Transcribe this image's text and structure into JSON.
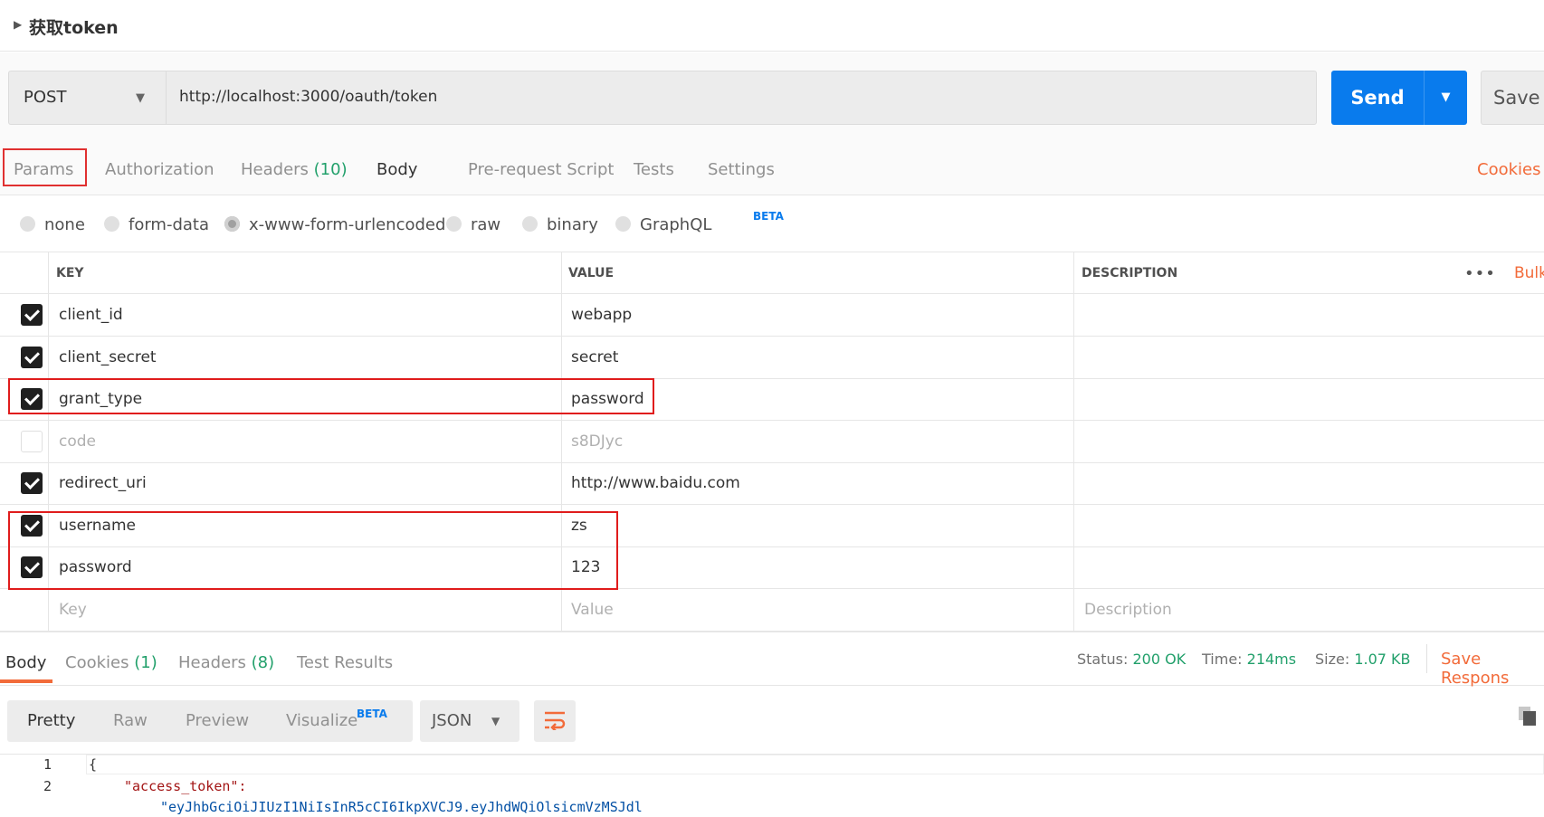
{
  "request": {
    "title": "获取token",
    "method": "POST",
    "url": "http://localhost:3000/oauth/token",
    "send_label": "Send",
    "save_label": "Save"
  },
  "tabs": {
    "params": "Params",
    "authorization": "Authorization",
    "headers": "Headers",
    "headers_count": "(10)",
    "body": "Body",
    "prerequest": "Pre-request Script",
    "tests": "Tests",
    "settings": "Settings",
    "cookies": "Cookies"
  },
  "body_modes": {
    "none": "none",
    "form_data": "form-data",
    "urlencoded": "x-www-form-urlencoded",
    "raw": "raw",
    "binary": "binary",
    "graphql": "GraphQL",
    "beta": "BETA",
    "selected": "x-www-form-urlencoded"
  },
  "table": {
    "headers": {
      "key": "KEY",
      "value": "VALUE",
      "description": "DESCRIPTION",
      "bulk": "Bulk"
    },
    "rows": [
      {
        "key": "client_id",
        "value": "webapp",
        "checked": true
      },
      {
        "key": "client_secret",
        "value": "secret",
        "checked": true
      },
      {
        "key": "grant_type",
        "value": "password",
        "checked": true
      },
      {
        "key": "code",
        "value": "s8DJyc",
        "checked": false
      },
      {
        "key": "redirect_uri",
        "value": "http://www.baidu.com",
        "checked": true
      },
      {
        "key": "username",
        "value": "zs",
        "checked": true
      },
      {
        "key": "password",
        "value": "123",
        "checked": true
      }
    ],
    "placeholders": {
      "key": "Key",
      "value": "Value",
      "description": "Description"
    }
  },
  "response": {
    "tabs": {
      "body": "Body",
      "cookies": "Cookies",
      "cookies_count": "(1)",
      "headers": "Headers",
      "headers_count": "(8)",
      "test_results": "Test Results"
    },
    "status_label": "Status:",
    "status_value": "200 OK",
    "time_label": "Time:",
    "time_value": "214ms",
    "size_label": "Size:",
    "size_value": "1.07 KB",
    "save_response": "Save Respons",
    "views": {
      "pretty": "Pretty",
      "raw": "Raw",
      "preview": "Preview",
      "visualize": "Visualize",
      "beta": "BETA"
    },
    "format": "JSON",
    "code": {
      "line1_no": "1",
      "line2_no": "2",
      "line1": "{",
      "line2_key": "\"access_token\":",
      "line3": "\"eyJhbGciOiJIUzI1NiIsInR5cCI6IkpXVCJ9.eyJhdWQiOlsicmVzMSJdl"
    }
  },
  "colors": {
    "accent": "#f26b3a",
    "send_blue": "#097bed",
    "count_green": "#22a06b",
    "highlight_red": "#e01c1c"
  }
}
